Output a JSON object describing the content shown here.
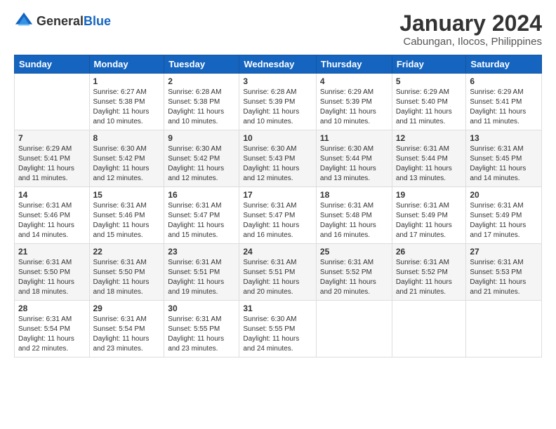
{
  "logo": {
    "general": "General",
    "blue": "Blue"
  },
  "title": "January 2024",
  "subtitle": "Cabungan, Ilocos, Philippines",
  "days_header": [
    "Sunday",
    "Monday",
    "Tuesday",
    "Wednesday",
    "Thursday",
    "Friday",
    "Saturday"
  ],
  "weeks": [
    [
      {
        "day": "",
        "sunrise": "",
        "sunset": "",
        "daylight": ""
      },
      {
        "day": "1",
        "sunrise": "Sunrise: 6:27 AM",
        "sunset": "Sunset: 5:38 PM",
        "daylight": "Daylight: 11 hours and 10 minutes."
      },
      {
        "day": "2",
        "sunrise": "Sunrise: 6:28 AM",
        "sunset": "Sunset: 5:38 PM",
        "daylight": "Daylight: 11 hours and 10 minutes."
      },
      {
        "day": "3",
        "sunrise": "Sunrise: 6:28 AM",
        "sunset": "Sunset: 5:39 PM",
        "daylight": "Daylight: 11 hours and 10 minutes."
      },
      {
        "day": "4",
        "sunrise": "Sunrise: 6:29 AM",
        "sunset": "Sunset: 5:39 PM",
        "daylight": "Daylight: 11 hours and 10 minutes."
      },
      {
        "day": "5",
        "sunrise": "Sunrise: 6:29 AM",
        "sunset": "Sunset: 5:40 PM",
        "daylight": "Daylight: 11 hours and 11 minutes."
      },
      {
        "day": "6",
        "sunrise": "Sunrise: 6:29 AM",
        "sunset": "Sunset: 5:41 PM",
        "daylight": "Daylight: 11 hours and 11 minutes."
      }
    ],
    [
      {
        "day": "7",
        "sunrise": "Sunrise: 6:29 AM",
        "sunset": "Sunset: 5:41 PM",
        "daylight": "Daylight: 11 hours and 11 minutes."
      },
      {
        "day": "8",
        "sunrise": "Sunrise: 6:30 AM",
        "sunset": "Sunset: 5:42 PM",
        "daylight": "Daylight: 11 hours and 12 minutes."
      },
      {
        "day": "9",
        "sunrise": "Sunrise: 6:30 AM",
        "sunset": "Sunset: 5:42 PM",
        "daylight": "Daylight: 11 hours and 12 minutes."
      },
      {
        "day": "10",
        "sunrise": "Sunrise: 6:30 AM",
        "sunset": "Sunset: 5:43 PM",
        "daylight": "Daylight: 11 hours and 12 minutes."
      },
      {
        "day": "11",
        "sunrise": "Sunrise: 6:30 AM",
        "sunset": "Sunset: 5:44 PM",
        "daylight": "Daylight: 11 hours and 13 minutes."
      },
      {
        "day": "12",
        "sunrise": "Sunrise: 6:31 AM",
        "sunset": "Sunset: 5:44 PM",
        "daylight": "Daylight: 11 hours and 13 minutes."
      },
      {
        "day": "13",
        "sunrise": "Sunrise: 6:31 AM",
        "sunset": "Sunset: 5:45 PM",
        "daylight": "Daylight: 11 hours and 14 minutes."
      }
    ],
    [
      {
        "day": "14",
        "sunrise": "Sunrise: 6:31 AM",
        "sunset": "Sunset: 5:46 PM",
        "daylight": "Daylight: 11 hours and 14 minutes."
      },
      {
        "day": "15",
        "sunrise": "Sunrise: 6:31 AM",
        "sunset": "Sunset: 5:46 PM",
        "daylight": "Daylight: 11 hours and 15 minutes."
      },
      {
        "day": "16",
        "sunrise": "Sunrise: 6:31 AM",
        "sunset": "Sunset: 5:47 PM",
        "daylight": "Daylight: 11 hours and 15 minutes."
      },
      {
        "day": "17",
        "sunrise": "Sunrise: 6:31 AM",
        "sunset": "Sunset: 5:47 PM",
        "daylight": "Daylight: 11 hours and 16 minutes."
      },
      {
        "day": "18",
        "sunrise": "Sunrise: 6:31 AM",
        "sunset": "Sunset: 5:48 PM",
        "daylight": "Daylight: 11 hours and 16 minutes."
      },
      {
        "day": "19",
        "sunrise": "Sunrise: 6:31 AM",
        "sunset": "Sunset: 5:49 PM",
        "daylight": "Daylight: 11 hours and 17 minutes."
      },
      {
        "day": "20",
        "sunrise": "Sunrise: 6:31 AM",
        "sunset": "Sunset: 5:49 PM",
        "daylight": "Daylight: 11 hours and 17 minutes."
      }
    ],
    [
      {
        "day": "21",
        "sunrise": "Sunrise: 6:31 AM",
        "sunset": "Sunset: 5:50 PM",
        "daylight": "Daylight: 11 hours and 18 minutes."
      },
      {
        "day": "22",
        "sunrise": "Sunrise: 6:31 AM",
        "sunset": "Sunset: 5:50 PM",
        "daylight": "Daylight: 11 hours and 18 minutes."
      },
      {
        "day": "23",
        "sunrise": "Sunrise: 6:31 AM",
        "sunset": "Sunset: 5:51 PM",
        "daylight": "Daylight: 11 hours and 19 minutes."
      },
      {
        "day": "24",
        "sunrise": "Sunrise: 6:31 AM",
        "sunset": "Sunset: 5:51 PM",
        "daylight": "Daylight: 11 hours and 20 minutes."
      },
      {
        "day": "25",
        "sunrise": "Sunrise: 6:31 AM",
        "sunset": "Sunset: 5:52 PM",
        "daylight": "Daylight: 11 hours and 20 minutes."
      },
      {
        "day": "26",
        "sunrise": "Sunrise: 6:31 AM",
        "sunset": "Sunset: 5:52 PM",
        "daylight": "Daylight: 11 hours and 21 minutes."
      },
      {
        "day": "27",
        "sunrise": "Sunrise: 6:31 AM",
        "sunset": "Sunset: 5:53 PM",
        "daylight": "Daylight: 11 hours and 21 minutes."
      }
    ],
    [
      {
        "day": "28",
        "sunrise": "Sunrise: 6:31 AM",
        "sunset": "Sunset: 5:54 PM",
        "daylight": "Daylight: 11 hours and 22 minutes."
      },
      {
        "day": "29",
        "sunrise": "Sunrise: 6:31 AM",
        "sunset": "Sunset: 5:54 PM",
        "daylight": "Daylight: 11 hours and 23 minutes."
      },
      {
        "day": "30",
        "sunrise": "Sunrise: 6:31 AM",
        "sunset": "Sunset: 5:55 PM",
        "daylight": "Daylight: 11 hours and 23 minutes."
      },
      {
        "day": "31",
        "sunrise": "Sunrise: 6:30 AM",
        "sunset": "Sunset: 5:55 PM",
        "daylight": "Daylight: 11 hours and 24 minutes."
      },
      {
        "day": "",
        "sunrise": "",
        "sunset": "",
        "daylight": ""
      },
      {
        "day": "",
        "sunrise": "",
        "sunset": "",
        "daylight": ""
      },
      {
        "day": "",
        "sunrise": "",
        "sunset": "",
        "daylight": ""
      }
    ]
  ]
}
